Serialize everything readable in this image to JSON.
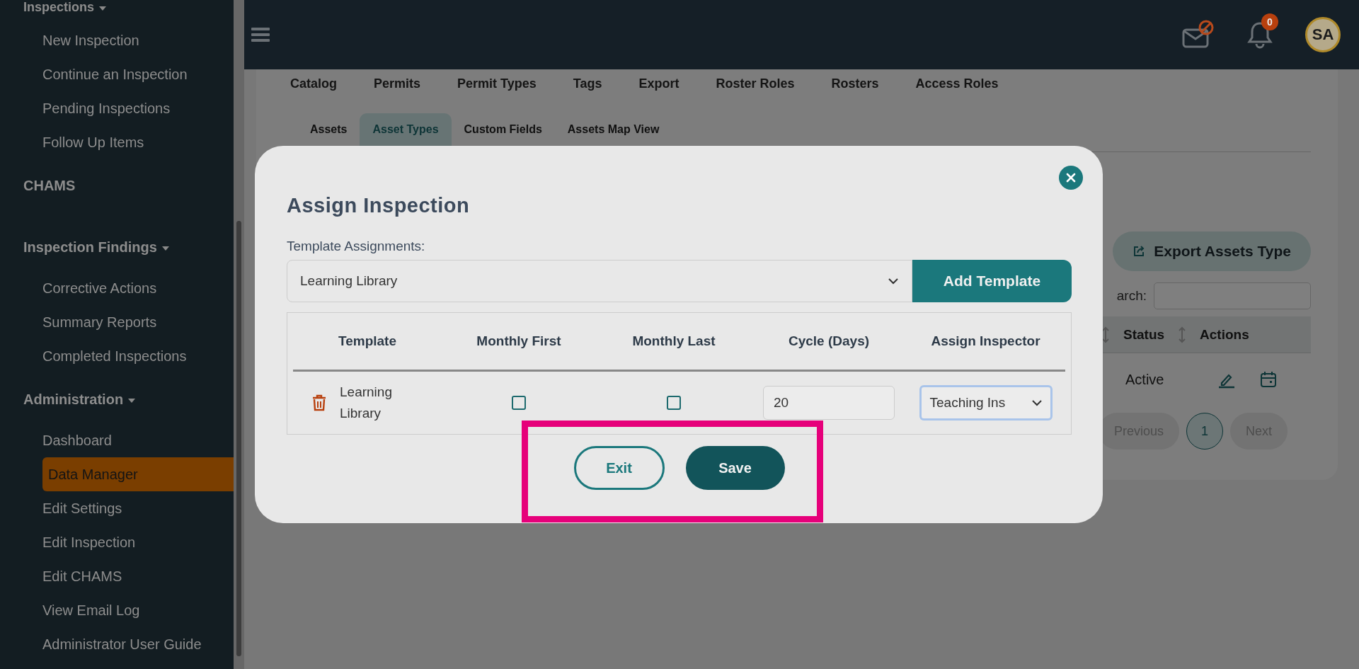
{
  "sidebar": {
    "sections": [
      {
        "title": "Inspections",
        "caret": true,
        "items": [
          {
            "label": "New Inspection",
            "selected": false
          },
          {
            "label": "Continue an Inspection",
            "selected": false
          },
          {
            "label": "Pending Inspections",
            "selected": false
          },
          {
            "label": "Follow Up Items",
            "selected": false
          }
        ]
      },
      {
        "title": "CHAMS",
        "caret": false
      },
      {
        "title": "Inspection Findings",
        "caret": true,
        "items": [
          {
            "label": "Corrective Actions",
            "selected": false
          },
          {
            "label": "Summary Reports",
            "selected": false
          },
          {
            "label": "Completed Inspections",
            "selected": false
          }
        ]
      },
      {
        "title": "Administration",
        "caret": true,
        "items": [
          {
            "label": "Dashboard",
            "selected": false
          },
          {
            "label": "Data Manager",
            "selected": true
          },
          {
            "label": "Edit Settings",
            "selected": false
          },
          {
            "label": "Edit Inspection",
            "selected": false
          },
          {
            "label": "Edit CHAMS",
            "selected": false
          },
          {
            "label": "View Email Log",
            "selected": false
          },
          {
            "label": "Administrator User Guide",
            "selected": false
          }
        ]
      }
    ]
  },
  "topbar": {
    "notification_count": "0",
    "avatar": "SA"
  },
  "page": {
    "primary_tabs": [
      "Catalog",
      "Permits",
      "Permit Types",
      "Tags",
      "Export",
      "Roster Roles",
      "Rosters",
      "Access Roles"
    ],
    "sub_tabs": [
      {
        "label": "Assets",
        "selected": false
      },
      {
        "label": "Asset Types",
        "selected": true
      },
      {
        "label": "Custom Fields",
        "selected": false
      },
      {
        "label": "Assets Map View",
        "selected": false
      }
    ],
    "export_button": "Export Assets Type",
    "search_label": "arch:",
    "table": {
      "columns": [
        "Status",
        "Actions"
      ],
      "rows": [
        {
          "status": "Active"
        }
      ]
    },
    "pagination": {
      "previous": "Previous",
      "pages": [
        {
          "label": "1",
          "selected": true
        }
      ],
      "next": "Next"
    }
  },
  "modal": {
    "title": "Assign Inspection",
    "label": "Template Assignments:",
    "template_select": "Learning Library",
    "add_button": "Add Template",
    "columns": [
      "Template",
      "Monthly First",
      "Monthly Last",
      "Cycle (Days)",
      "Assign Inspector"
    ],
    "rows": [
      {
        "template": "Learning Library",
        "monthly_first": false,
        "monthly_last": false,
        "cycle": "20",
        "inspector": "Teaching Ins"
      }
    ],
    "buttons": [
      {
        "label": "Exit",
        "kind": "outline"
      },
      {
        "label": "Save",
        "kind": "primary"
      }
    ]
  }
}
